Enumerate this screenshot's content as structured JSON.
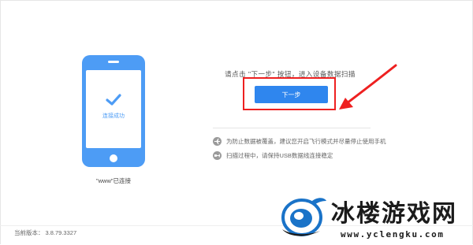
{
  "phone": {
    "status": "连接成功",
    "device_name": "\"www\"已连接",
    "icon": "check-icon"
  },
  "main": {
    "instruction": "请点击 \"下一步\" 按钮，进入设备数据扫描",
    "next_button": "下一步"
  },
  "tips": [
    {
      "icon": "airplane-icon",
      "text": "为防止数据被覆盖，建议您开启飞行模式并尽量停止使用手机"
    },
    {
      "icon": "usb-icon",
      "text": "扫描过程中，请保持USB数据线连接稳定"
    }
  ],
  "footer": {
    "version_label": "当前版本：",
    "version_number": "3.8.79.3327"
  },
  "watermark": {
    "title": "冰楼游戏网",
    "url": "www.yclengku.com"
  },
  "colors": {
    "phone": "#4d9cf5",
    "button": "#2f86ee",
    "highlight": "#ee2020",
    "watermark_blue": "#1a73c8"
  }
}
